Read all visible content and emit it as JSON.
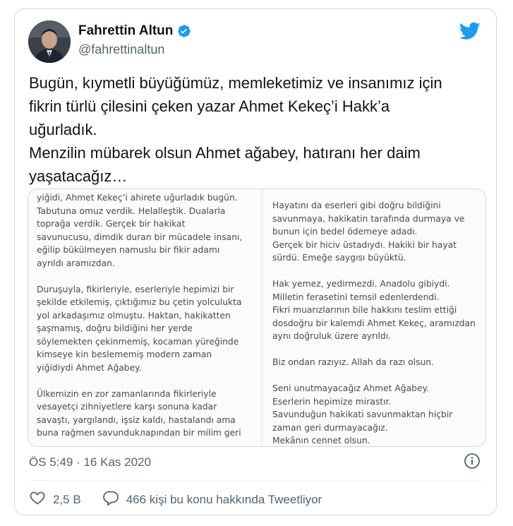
{
  "author": {
    "name": "Fahrettin Altun",
    "handle": "@fahrettinaltun"
  },
  "tweet": {
    "text": "Bugün, kıymetli büyüğümüz, memleketimiz ve insanımız için\nfikrin türlü çilesini çeken yazar Ahmet Kekeç’i Hakk’a\nuğurladık.\nMenzilin mübarek olsun Ahmet ağabey, hatıranı her daim\nyaşatacağız…"
  },
  "media": {
    "left_paragraphs": [
      "yiğidi, Ahmet Kekeç’i ahirete uğurladık bugün.\nTabutuna omuz verdik. Helalleştik. Dualarla\ntoprağa verdik. Gerçek bir hakikat\nsavunucusu, dimdik duran bir mücadele insanı,\neğilip bükülmeyen namuslu bir fikir adamı\nayrıldı aramızdan.",
      "Duruşuyla, fikirleriyle, eserleriyle hepimizi bir\nşekilde etkilemiş, çıktığımız bu çetin yolculukta\nyol arkadaşımız olmuştu. Haktan, hakikatten\nşaşmamış, doğru bildiğini her yerde\nsöylemekten çekinmemiş, kocaman yüreğinde\nkimseye kin beslememiş modern zaman\nyiğidiydi Ahmet Ağabey.",
      "Ülkemizin en zor zamanlarında fikirleriyle\nvesayetçi zihniyetlere karşı sonuna kadar\nsavaştı, yargılandı, işsiz kaldı, hastalandı ama\nbuna rağmen savundukларından bir milim geri"
    ],
    "right_paragraphs": [
      "Hayatını da eserleri gibi doğru bildiğini\nsavunmaya, hakikatin tarafında durmaya ve\nbunun için bedel ödemeye adadı.\nGerçek bir hiciv üstadıydı. Hakiki bir hayat\nsürdü. Emeğe saygısı büyüktü.",
      "Hak yemez, yedirmezdi. Anadolu gibiydi.\nMilletin ferasetini temsil edenlerdendi.\nFikri muarızlarının bile hakkını teslim ettiği\ndosdoğru bir kalemdi Ahmet Kekeç, aramızdan\naynı doğruluk üzere ayrıldı.",
      "Biz ondan razıyız. Allah da razı olsun.",
      "Seni unutmayacağız Ahmet Ağabey.\nEserlerin hepimize mirastır.\nSavunduğun hakikati savunmaktan hiçbir\nzaman geri durmayacağız.\nMekânın cennet olsun."
    ]
  },
  "meta": {
    "timestamp": "ÖS 5:49 · 16 Kas 2020"
  },
  "actions": {
    "likes": "2,5 B",
    "replies": "466 kişi bu konu hakkında Tweetliyor"
  },
  "colors": {
    "twitter_blue": "#1d9bf0",
    "secondary_text": "#536471"
  },
  "icons": [
    "twitter-logo-icon",
    "verified-badge-icon",
    "info-icon",
    "heart-icon",
    "reply-bubble-icon"
  ]
}
